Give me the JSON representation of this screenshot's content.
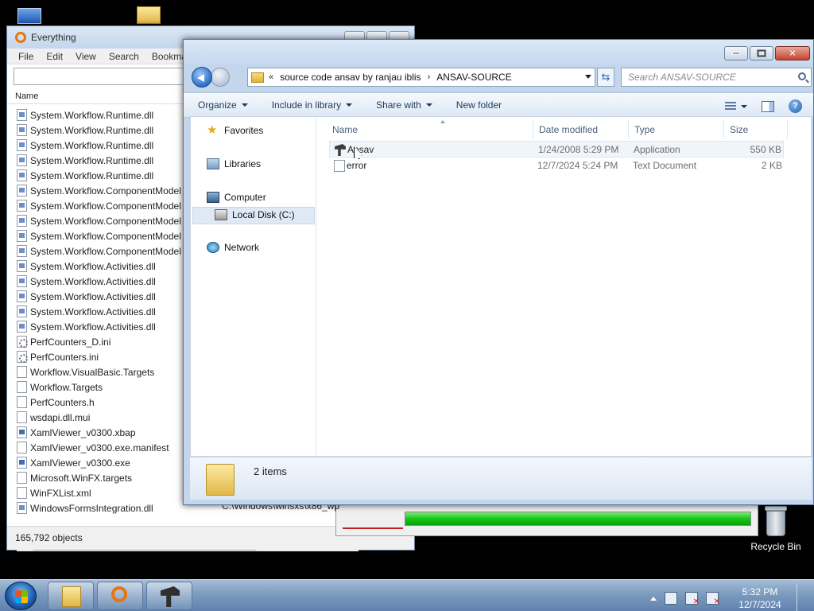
{
  "everything": {
    "title": "Everything",
    "menu": [
      "File",
      "Edit",
      "View",
      "Search",
      "Bookmark"
    ],
    "column_header": "Name",
    "files": [
      {
        "name": "System.Workflow.Runtime.dll",
        "icon": "dll"
      },
      {
        "name": "System.Workflow.Runtime.dll",
        "icon": "dll"
      },
      {
        "name": "System.Workflow.Runtime.dll",
        "icon": "dll"
      },
      {
        "name": "System.Workflow.Runtime.dll",
        "icon": "dll"
      },
      {
        "name": "System.Workflow.Runtime.dll",
        "icon": "dll"
      },
      {
        "name": "System.Workflow.ComponentModel",
        "icon": "dll"
      },
      {
        "name": "System.Workflow.ComponentModel",
        "icon": "dll"
      },
      {
        "name": "System.Workflow.ComponentModel",
        "icon": "dll"
      },
      {
        "name": "System.Workflow.ComponentModel",
        "icon": "dll"
      },
      {
        "name": "System.Workflow.ComponentModel",
        "icon": "dll"
      },
      {
        "name": "System.Workflow.Activities.dll",
        "icon": "dll"
      },
      {
        "name": "System.Workflow.Activities.dll",
        "icon": "dll"
      },
      {
        "name": "System.Workflow.Activities.dll",
        "icon": "dll"
      },
      {
        "name": "System.Workflow.Activities.dll",
        "icon": "dll"
      },
      {
        "name": "System.Workflow.Activities.dll",
        "icon": "dll"
      },
      {
        "name": "PerfCounters_D.ini",
        "icon": "ini"
      },
      {
        "name": "PerfCounters.ini",
        "icon": "ini"
      },
      {
        "name": "Workflow.VisualBasic.Targets",
        "icon": "file"
      },
      {
        "name": "Workflow.Targets",
        "icon": "file"
      },
      {
        "name": "PerfCounters.h",
        "icon": "file"
      },
      {
        "name": "wsdapi.dll.mui",
        "icon": "file"
      },
      {
        "name": "XamlViewer_v0300.xbap",
        "icon": "exe"
      },
      {
        "name": "XamlViewer_v0300.exe.manifest",
        "icon": "file"
      },
      {
        "name": "XamlViewer_v0300.exe",
        "icon": "exe"
      },
      {
        "name": "Microsoft.WinFX.targets",
        "icon": "file"
      },
      {
        "name": "WinFXList.xml",
        "icon": "file"
      },
      {
        "name": "WindowsFormsIntegration.dll",
        "icon": "dll"
      }
    ],
    "status": "165,792 objects",
    "path_fragment": "C:\\Windows\\winsxs\\x86_wp"
  },
  "progress": {
    "percent": 100,
    "color": "#16c716"
  },
  "explorer": {
    "address": {
      "overflow": "«",
      "crumbs": [
        "source code ansav by ranjau iblis",
        "ANSAV-SOURCE"
      ],
      "separator": "›"
    },
    "search_placeholder": "Search ANSAV-SOURCE",
    "toolbar": {
      "organize": "Organize",
      "include": "Include in library",
      "share": "Share with",
      "new_folder": "New folder"
    },
    "nav": {
      "favorites": "Favorites",
      "libraries": "Libraries",
      "computer": "Computer",
      "local_disk": "Local Disk (C:)",
      "network": "Network"
    },
    "columns": {
      "name": "Name",
      "date": "Date modified",
      "type": "Type",
      "size": "Size"
    },
    "files": [
      {
        "name": "Ansav",
        "date": "1/24/2008 5:29 PM",
        "type": "Application",
        "size": "550 KB",
        "icon": "app"
      },
      {
        "name": "error",
        "date": "12/7/2024 5:24 PM",
        "type": "Text Document",
        "size": "2 KB",
        "icon": "txt"
      }
    ],
    "item_count": "2 items"
  },
  "desktop": {
    "recycle_bin": "Recycle Bin"
  },
  "taskbar": {
    "time": "5:32 PM",
    "date": "12/7/2024"
  }
}
